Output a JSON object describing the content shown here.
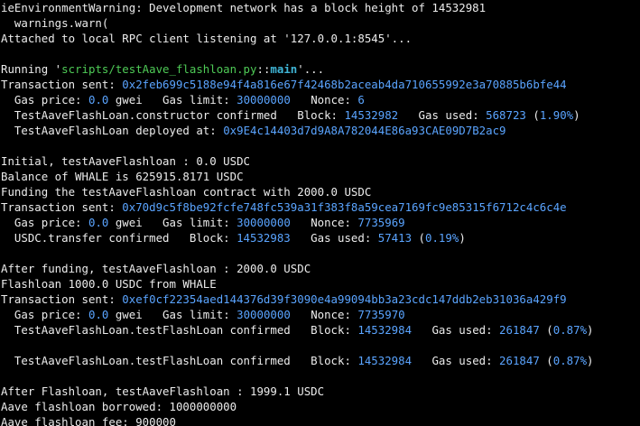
{
  "terminal": {
    "colors": {
      "background": "#000000",
      "default": "#ececec",
      "green": "#4eca56",
      "cyan": "#3fb5d6",
      "blue": "#5aa4ff"
    },
    "lines": [
      {
        "segments": [
          {
            "text": "ieEnvironmentWarning: Development network has a block height of 14532981",
            "color": "default"
          }
        ]
      },
      {
        "segments": [
          {
            "text": "  warnings.warn(",
            "color": "default"
          }
        ]
      },
      {
        "segments": [
          {
            "text": "Attached to local RPC client listening at '127.0.0.1:8545'...",
            "color": "default"
          }
        ]
      },
      {
        "segments": []
      },
      {
        "segments": [
          {
            "text": "Running '",
            "color": "default"
          },
          {
            "text": "scripts/testAave_flashloan.py",
            "color": "green"
          },
          {
            "text": "::",
            "color": "default"
          },
          {
            "text": "main",
            "color": "cyan",
            "bold": true
          },
          {
            "text": "'...",
            "color": "default"
          }
        ]
      },
      {
        "segments": [
          {
            "text": "Transaction sent: ",
            "color": "default"
          },
          {
            "text": "0x2feb699c5188e94f4a816e67f42468b2aceab4da710655992e3a70885b6bfe44",
            "color": "blue"
          }
        ]
      },
      {
        "segments": [
          {
            "text": "  Gas price: ",
            "color": "default"
          },
          {
            "text": "0.0",
            "color": "blue"
          },
          {
            "text": " gwei   Gas limit: ",
            "color": "default"
          },
          {
            "text": "30000000",
            "color": "blue"
          },
          {
            "text": "   Nonce: ",
            "color": "default"
          },
          {
            "text": "6",
            "color": "blue"
          }
        ]
      },
      {
        "segments": [
          {
            "text": "  TestAaveFlashLoan.constructor confirmed   Block: ",
            "color": "default"
          },
          {
            "text": "14532982",
            "color": "blue"
          },
          {
            "text": "   Gas used: ",
            "color": "default"
          },
          {
            "text": "568723",
            "color": "blue"
          },
          {
            "text": " (",
            "color": "default"
          },
          {
            "text": "1.90%",
            "color": "blue"
          },
          {
            "text": ")",
            "color": "default"
          }
        ]
      },
      {
        "segments": [
          {
            "text": "  TestAaveFlashLoan deployed at: ",
            "color": "default"
          },
          {
            "text": "0x9E4c14403d7d9A8A782044E86a93CAE09D7B2ac9",
            "color": "blue"
          }
        ]
      },
      {
        "segments": []
      },
      {
        "segments": [
          {
            "text": "Initial, testAaveFlashloan : 0.0 USDC",
            "color": "default"
          }
        ]
      },
      {
        "segments": [
          {
            "text": "Balance of WHALE is 625915.8171 USDC",
            "color": "default"
          }
        ]
      },
      {
        "segments": [
          {
            "text": "Funding the testAaveFlashloan contract with 2000.0 USDC",
            "color": "default"
          }
        ]
      },
      {
        "segments": [
          {
            "text": "Transaction sent: ",
            "color": "default"
          },
          {
            "text": "0x70d9c5f8be92fcfe748fc539a31f383f8a59cea7169fc9e85315f6712c4c6c4e",
            "color": "blue"
          }
        ]
      },
      {
        "segments": [
          {
            "text": "  Gas price: ",
            "color": "default"
          },
          {
            "text": "0.0",
            "color": "blue"
          },
          {
            "text": " gwei   Gas limit: ",
            "color": "default"
          },
          {
            "text": "30000000",
            "color": "blue"
          },
          {
            "text": "   Nonce: ",
            "color": "default"
          },
          {
            "text": "7735969",
            "color": "blue"
          }
        ]
      },
      {
        "segments": [
          {
            "text": "  USDC.transfer confirmed   Block: ",
            "color": "default"
          },
          {
            "text": "14532983",
            "color": "blue"
          },
          {
            "text": "   Gas used: ",
            "color": "default"
          },
          {
            "text": "57413",
            "color": "blue"
          },
          {
            "text": " (",
            "color": "default"
          },
          {
            "text": "0.19%",
            "color": "blue"
          },
          {
            "text": ")",
            "color": "default"
          }
        ]
      },
      {
        "segments": []
      },
      {
        "segments": [
          {
            "text": "After funding, testAaveFlashloan : 2000.0 USDC",
            "color": "default"
          }
        ]
      },
      {
        "segments": [
          {
            "text": "Flashloan 1000.0 USDC from WHALE",
            "color": "default"
          }
        ]
      },
      {
        "segments": [
          {
            "text": "Transaction sent: ",
            "color": "default"
          },
          {
            "text": "0xef0cf22354aed144376d39f3090e4a99094bb3a23cdc147ddb2eb31036a429f9",
            "color": "blue"
          }
        ]
      },
      {
        "segments": [
          {
            "text": "  Gas price: ",
            "color": "default"
          },
          {
            "text": "0.0",
            "color": "blue"
          },
          {
            "text": " gwei   Gas limit: ",
            "color": "default"
          },
          {
            "text": "30000000",
            "color": "blue"
          },
          {
            "text": "   Nonce: ",
            "color": "default"
          },
          {
            "text": "7735970",
            "color": "blue"
          }
        ]
      },
      {
        "segments": [
          {
            "text": "  TestAaveFlashLoan.testFlashLoan confirmed   Block: ",
            "color": "default"
          },
          {
            "text": "14532984",
            "color": "blue"
          },
          {
            "text": "   Gas used: ",
            "color": "default"
          },
          {
            "text": "261847",
            "color": "blue"
          },
          {
            "text": " (",
            "color": "default"
          },
          {
            "text": "0.87%",
            "color": "blue"
          },
          {
            "text": ")",
            "color": "default"
          }
        ]
      },
      {
        "segments": []
      },
      {
        "segments": [
          {
            "text": "  TestAaveFlashLoan.testFlashLoan confirmed   Block: ",
            "color": "default"
          },
          {
            "text": "14532984",
            "color": "blue"
          },
          {
            "text": "   Gas used: ",
            "color": "default"
          },
          {
            "text": "261847",
            "color": "blue"
          },
          {
            "text": " (",
            "color": "default"
          },
          {
            "text": "0.87%",
            "color": "blue"
          },
          {
            "text": ")",
            "color": "default"
          }
        ]
      },
      {
        "segments": []
      },
      {
        "segments": [
          {
            "text": "After Flashloan, testAaveFlashloan : 1999.1 USDC",
            "color": "default"
          }
        ]
      },
      {
        "segments": [
          {
            "text": "Aave flashloan borrowed: 1000000000",
            "color": "default"
          }
        ]
      },
      {
        "segments": [
          {
            "text": "Aave flashloan fee: 900000",
            "color": "default"
          }
        ]
      }
    ]
  }
}
